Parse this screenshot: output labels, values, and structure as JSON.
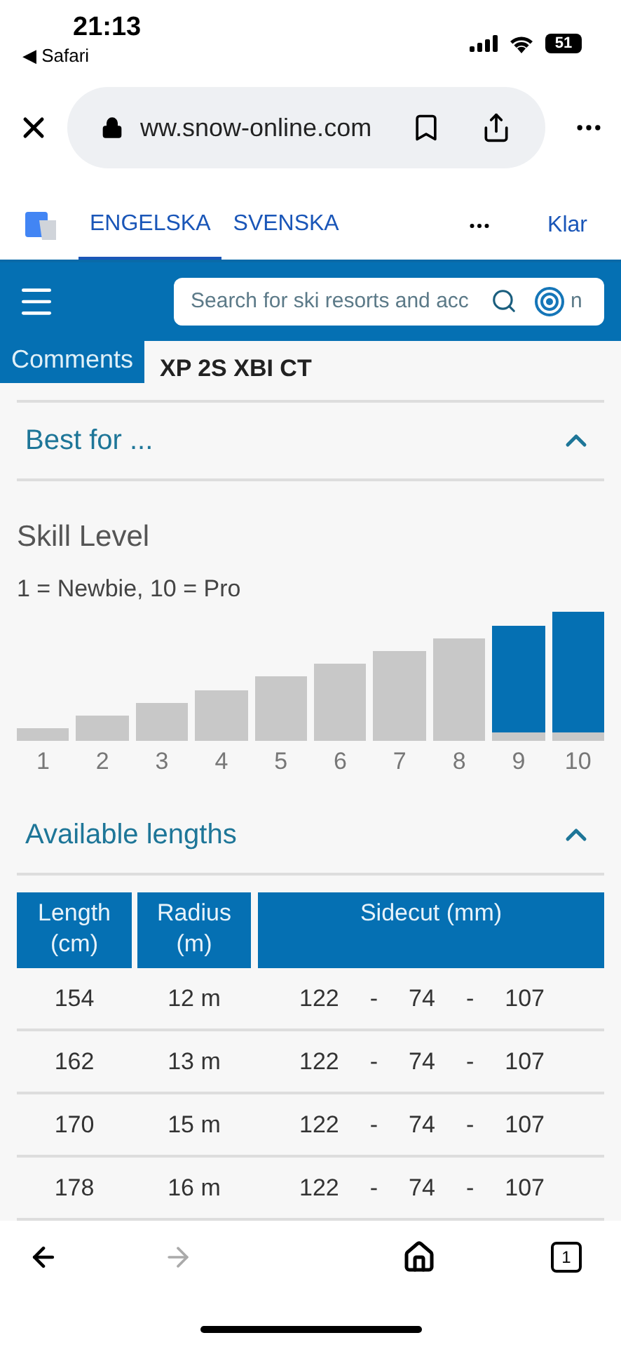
{
  "status_bar": {
    "time": "21:13",
    "back_app": "◀ Safari",
    "battery": "51"
  },
  "address_bar": {
    "url": "ww.snow-online.com"
  },
  "translate_bar": {
    "tabs": [
      {
        "label": "ENGELSKA",
        "selected": true
      },
      {
        "label": "SVENSKA",
        "selected": false
      }
    ],
    "done": "Klar"
  },
  "site_header": {
    "search": {
      "placeholder": "Search for ski resorts and acc",
      "fragment": "n"
    }
  },
  "comments_tab": "Comments",
  "product_title": "XP 2S XBI CT",
  "best_for": {
    "title": "Best for ...",
    "expanded": true,
    "skill_title": "Skill Level",
    "skill_scale": "1 = Newbie, 10 = Pro",
    "levels": [
      {
        "label": "1",
        "selected": false
      },
      {
        "label": "2",
        "selected": false
      },
      {
        "label": "3",
        "selected": false
      },
      {
        "label": "4",
        "selected": false
      },
      {
        "label": "5",
        "selected": false
      },
      {
        "label": "6",
        "selected": false
      },
      {
        "label": "7",
        "selected": false
      },
      {
        "label": "8",
        "selected": false
      },
      {
        "label": "9",
        "selected": true
      },
      {
        "label": "10",
        "selected": true
      }
    ]
  },
  "lengths": {
    "title": "Available lengths",
    "expanded": true,
    "columns": [
      "Length (cm)",
      "Radius (m)",
      "Sidecut (mm)"
    ],
    "rows": [
      {
        "length": "154",
        "radius": "12 m",
        "sidecut": [
          "122",
          "-",
          "74",
          "-",
          "107"
        ]
      },
      {
        "length": "162",
        "radius": "13 m",
        "sidecut": [
          "122",
          "-",
          "74",
          "-",
          "107"
        ]
      },
      {
        "length": "170",
        "radius": "15 m",
        "sidecut": [
          "122",
          "-",
          "74",
          "-",
          "107"
        ]
      },
      {
        "length": "178",
        "radius": "16 m",
        "sidecut": [
          "122",
          "-",
          "74",
          "-",
          "107"
        ]
      }
    ]
  },
  "toolbar": {
    "forward_disabled": true,
    "tab_count": "1"
  }
}
